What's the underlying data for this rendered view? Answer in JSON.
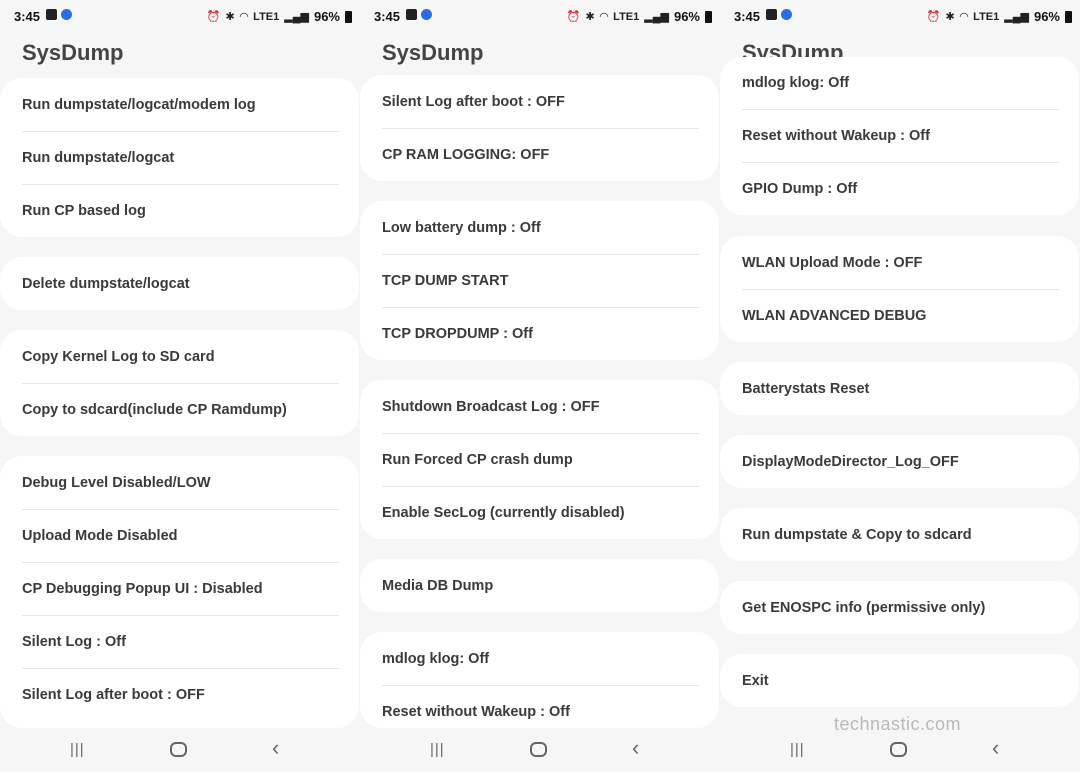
{
  "status": {
    "time": "3:45",
    "battery": "96%",
    "network": "LTE1"
  },
  "app_title": "SysDump",
  "panel1": {
    "groups": [
      [
        "Run dumpstate/logcat/modem log",
        "Run dumpstate/logcat",
        "Run CP based log"
      ],
      [
        "Delete dumpstate/logcat"
      ],
      [
        "Copy Kernel Log to SD card",
        "Copy to sdcard(include CP Ramdump)"
      ],
      [
        "Debug Level Disabled/LOW",
        "Upload Mode Disabled",
        "CP Debugging Popup UI : Disabled",
        "Silent Log : Off",
        "Silent Log after boot : OFF"
      ]
    ]
  },
  "panel2": {
    "groups": [
      [
        "Silent Log after boot : OFF",
        "CP RAM LOGGING: OFF"
      ],
      [
        "Low battery dump : Off",
        "TCP DUMP START",
        "TCP DROPDUMP : Off"
      ],
      [
        "Shutdown Broadcast Log : OFF",
        "Run Forced CP crash dump",
        "Enable SecLog (currently disabled)"
      ],
      [
        "Media DB Dump"
      ],
      [
        "mdlog klog: Off",
        "Reset without Wakeup : Off"
      ]
    ]
  },
  "panel3": {
    "groups": [
      [
        "mdlog klog: Off",
        "Reset without Wakeup : Off",
        "GPIO Dump : Off"
      ],
      [
        "WLAN Upload Mode : OFF",
        "WLAN ADVANCED DEBUG"
      ],
      [
        "Batterystats Reset"
      ],
      [
        "DisplayModeDirector_Log_OFF"
      ],
      [
        "Run dumpstate & Copy to sdcard"
      ],
      [
        "Get ENOSPC info (permissive only)"
      ],
      [
        "Exit"
      ]
    ]
  },
  "watermark": "technastic.com",
  "icons": {
    "status_left": [
      "image-icon",
      "app-badge-icon"
    ],
    "status_right": [
      "alarm-icon",
      "bluetooth-icon",
      "wifi-icon",
      "volte-icon",
      "signal-icon",
      "battery-icon"
    ],
    "nav": [
      "recent-apps-icon",
      "home-icon",
      "back-icon"
    ]
  }
}
